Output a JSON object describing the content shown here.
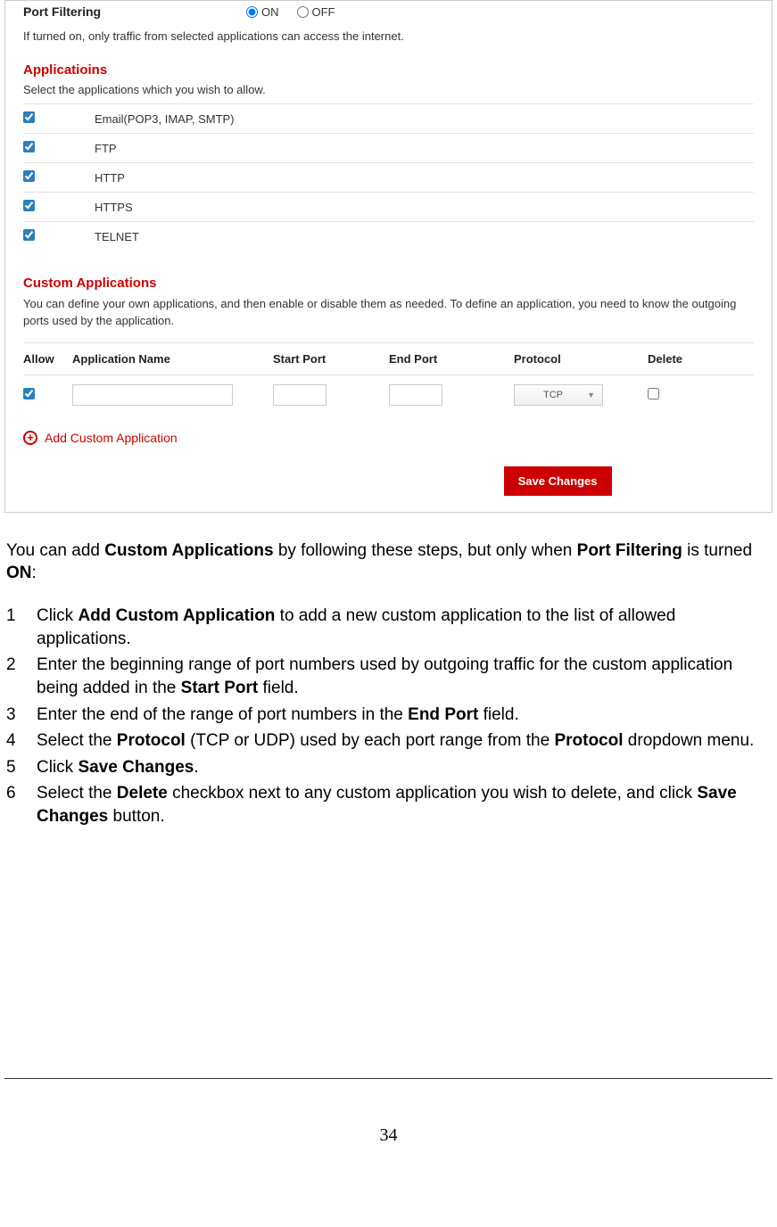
{
  "port_filtering": {
    "label": "Port Filtering",
    "on_label": "ON",
    "off_label": "OFF",
    "selected": "ON",
    "description": "If turned on, only traffic from selected applications can access the internet."
  },
  "applications": {
    "title": "Applicatioins",
    "description": "Select the applications which you wish to allow.",
    "items": [
      {
        "checked": true,
        "name": "Email(POP3, IMAP, SMTP)"
      },
      {
        "checked": true,
        "name": "FTP"
      },
      {
        "checked": true,
        "name": "HTTP"
      },
      {
        "checked": true,
        "name": "HTTPS"
      },
      {
        "checked": true,
        "name": "TELNET"
      }
    ]
  },
  "custom": {
    "title": "Custom Applications",
    "description": "You can define your own applications, and then enable or disable them as needed. To define an application, you need to know the outgoing ports used by the application.",
    "headers": {
      "allow": "Allow",
      "appname": "Application Name",
      "start": "Start Port",
      "end": "End Port",
      "protocol": "Protocol",
      "delete": "Delete"
    },
    "row": {
      "allow_checked": true,
      "app_name": "",
      "start_port": "",
      "end_port": "",
      "protocol": "TCP",
      "delete_checked": false
    },
    "add_label": "Add Custom Application",
    "save_label": "Save Changes"
  },
  "doc": {
    "intro": {
      "p1a": "You can add ",
      "p1b": "Custom Applications",
      "p1c": " by following these steps, but only when ",
      "p1d": "Port Filtering",
      "p1e": " is turned ",
      "p1f": "ON",
      "p1g": ":"
    },
    "steps": [
      {
        "n": "1",
        "parts": [
          "Click ",
          "Add Custom Application",
          " to add a new custom application to the list of allowed applications."
        ]
      },
      {
        "n": "2",
        "parts": [
          "Enter the beginning range of port numbers used by outgoing traffic for the custom application being added in the ",
          "Start Port",
          " field."
        ]
      },
      {
        "n": "3",
        "parts": [
          "Enter the end of the range of port numbers in the ",
          "End Port",
          " field."
        ]
      },
      {
        "n": "4",
        "parts": [
          "Select the ",
          "Protocol",
          " (TCP or UDP) used by each port range from the ",
          "Protocol",
          " dropdown menu."
        ]
      },
      {
        "n": "5",
        "parts": [
          "Click ",
          "Save Changes",
          "."
        ]
      },
      {
        "n": "6",
        "parts": [
          "Select the ",
          "Delete",
          " checkbox next to any custom application you wish to delete, and click ",
          "Save Changes",
          " button."
        ]
      }
    ],
    "page_number": "34"
  }
}
